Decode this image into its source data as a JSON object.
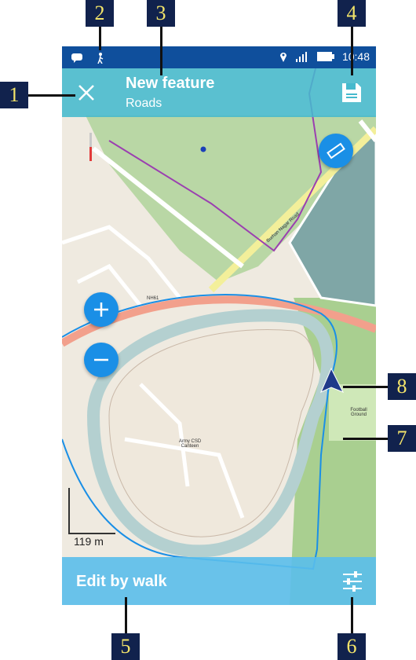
{
  "status_bar": {
    "time": "10:48"
  },
  "toolbar": {
    "title": "New feature",
    "subtitle": "Roads"
  },
  "bottom_bar": {
    "label": "Edit by walk"
  },
  "map": {
    "scale_label": "119 m",
    "labels": {
      "road": "Burhan Nagar Road",
      "highway": "NH61",
      "poi": "Army CSD Canteen",
      "field": "Football Ground"
    }
  },
  "callouts": [
    "1",
    "2",
    "3",
    "4",
    "5",
    "6",
    "7",
    "8"
  ],
  "colors": {
    "status_bar": "#0f4f9c",
    "toolbar": "#46b9cd",
    "bottom_bar": "#5abeeb",
    "fab": "#1a8fe6",
    "callout_bg": "#11224d",
    "callout_text": "#f3e46a"
  }
}
